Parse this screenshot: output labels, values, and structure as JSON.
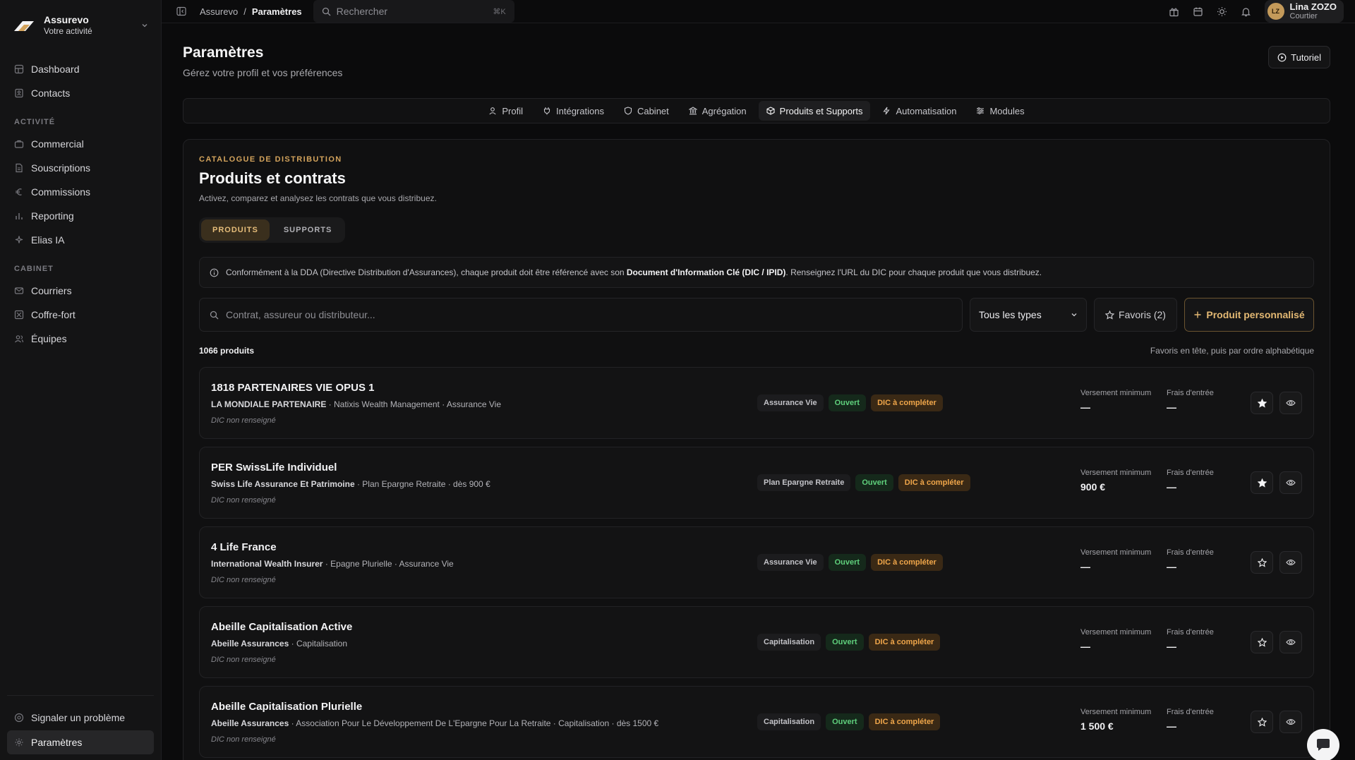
{
  "brand": {
    "name": "Assurevo",
    "subtitle": "Votre activité"
  },
  "sidebar": {
    "main_items": [
      {
        "label": "Dashboard",
        "icon": "dashboard-icon"
      },
      {
        "label": "Contacts",
        "icon": "contacts-icon"
      }
    ],
    "section_activite": "ACTIVITÉ",
    "activite_items": [
      {
        "label": "Commercial",
        "icon": "briefcase-icon"
      },
      {
        "label": "Souscriptions",
        "icon": "document-icon"
      },
      {
        "label": "Commissions",
        "icon": "euro-icon"
      },
      {
        "label": "Reporting",
        "icon": "bar-chart-icon"
      },
      {
        "label": "Elias IA",
        "icon": "sparkles-icon"
      }
    ],
    "section_cabinet": "CABINET",
    "cabinet_items": [
      {
        "label": "Courriers",
        "icon": "mail-icon"
      },
      {
        "label": "Coffre-fort",
        "icon": "safe-icon"
      },
      {
        "label": "Équipes",
        "icon": "users-icon"
      }
    ],
    "bottom_items": [
      {
        "label": "Signaler un problème",
        "icon": "help-icon"
      },
      {
        "label": "Paramètres",
        "icon": "gear-icon"
      }
    ]
  },
  "topbar": {
    "breadcrumb_root": "Assurevo",
    "breadcrumb_sep": "/",
    "breadcrumb_current": "Paramètres",
    "search_placeholder": "Rechercher",
    "search_shortcut": "⌘K",
    "user": {
      "initials": "LZ",
      "name": "Lina ZOZO",
      "role": "Courtier"
    }
  },
  "page": {
    "title": "Paramètres",
    "subtitle": "Gérez votre profil et vos préférences",
    "tutorial_label": "Tutoriel"
  },
  "tabs": [
    {
      "label": "Profil",
      "icon": "user-icon"
    },
    {
      "label": "Intégrations",
      "icon": "plug-icon"
    },
    {
      "label": "Cabinet",
      "icon": "shield-icon"
    },
    {
      "label": "Agrégation",
      "icon": "bank-icon"
    },
    {
      "label": "Produits et Supports",
      "icon": "package-icon",
      "active": true
    },
    {
      "label": "Automatisation",
      "icon": "bolt-icon"
    },
    {
      "label": "Modules",
      "icon": "sliders-icon"
    }
  ],
  "catalog": {
    "eyebrow": "CATALOGUE DE DISTRIBUTION",
    "title": "Produits et contrats",
    "subtitle": "Activez, comparez et analysez les contrats que vous distribuez.",
    "segments": [
      "PRODUITS",
      "SUPPORTS"
    ],
    "notice_pre": "Conformément à la DDA (Directive Distribution d'Assurances), chaque produit doit être référencé avec son ",
    "notice_bold": "Document d'Information Clé (DIC / IPID)",
    "notice_post": ". Renseignez l'URL du DIC pour chaque produit que vous distribuez.",
    "search_placeholder": "Contrat, assureur ou distributeur...",
    "type_filter": "Tous les types",
    "favorites_label": "Favoris (2)",
    "custom_product_label": "Produit personnalisé",
    "count": "1066 produits",
    "order_note": "Favoris en tête, puis par ordre alphabétique",
    "metric_min_label": "Versement minimum",
    "metric_fee_label": "Frais d'entrée"
  },
  "products": [
    {
      "name": "1818 PARTENAIRES VIE OPUS 1",
      "insurer": "LA MONDIALE PARTENAIRE",
      "meta": " · Natixis Wealth Management · Assurance Vie",
      "dic": "DIC non renseigné",
      "type": "Assurance Vie",
      "status": "Ouvert",
      "dic_badge": "DIC à compléter",
      "min": "—",
      "fee": "—",
      "favorite": true
    },
    {
      "name": "PER SwissLife Individuel",
      "insurer": "Swiss Life Assurance Et Patrimoine",
      "meta": " · Plan Epargne Retraite · dès 900 €",
      "dic": "DIC non renseigné",
      "type": "Plan Epargne Retraite",
      "status": "Ouvert",
      "dic_badge": "DIC à compléter",
      "min": "900 €",
      "fee": "—",
      "favorite": true
    },
    {
      "name": "4 Life France",
      "insurer": "International Wealth Insurer",
      "meta": " · Epagne Plurielle · Assurance Vie",
      "dic": "DIC non renseigné",
      "type": "Assurance Vie",
      "status": "Ouvert",
      "dic_badge": "DIC à compléter",
      "min": "—",
      "fee": "—",
      "favorite": false
    },
    {
      "name": "Abeille Capitalisation Active",
      "insurer": "Abeille Assurances",
      "meta": " · Capitalisation",
      "dic": "DIC non renseigné",
      "type": "Capitalisation",
      "status": "Ouvert",
      "dic_badge": "DIC à compléter",
      "min": "—",
      "fee": "—",
      "favorite": false
    },
    {
      "name": "Abeille Capitalisation Plurielle",
      "insurer": "Abeille Assurances",
      "meta": " · Association Pour Le Développement De L'Epargne Pour La Retraite · Capitalisation · dès 1500 €",
      "dic": "DIC non renseigné",
      "type": "Capitalisation",
      "status": "Ouvert",
      "dic_badge": "DIC à compléter",
      "min": "1 500 €",
      "fee": "—",
      "favorite": false
    }
  ],
  "colors": {
    "accent": "#d3a35c",
    "open_green": "#5fd07c",
    "dic_orange": "#f0a64a"
  }
}
